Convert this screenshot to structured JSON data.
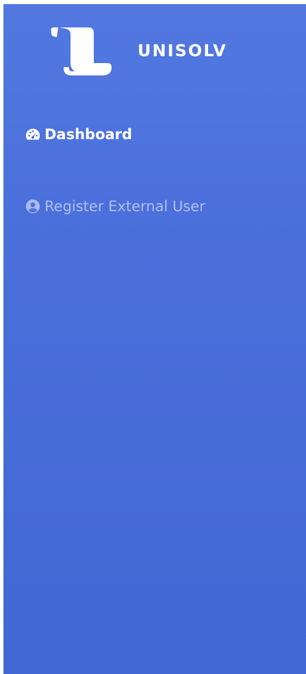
{
  "brand": {
    "name": "UNISOLV",
    "logo_icon": "scroll-icon"
  },
  "nav": {
    "items": [
      {
        "label": "Dashboard",
        "icon": "tachometer-icon",
        "active": true
      },
      {
        "label": "Register External User",
        "icon": "user-circle-icon",
        "active": false
      }
    ]
  },
  "colors": {
    "sidebar_top": "#5278e0",
    "sidebar_bottom": "#4268d5",
    "active_text": "#ffffff",
    "inactive_text": "#a9bbef"
  }
}
